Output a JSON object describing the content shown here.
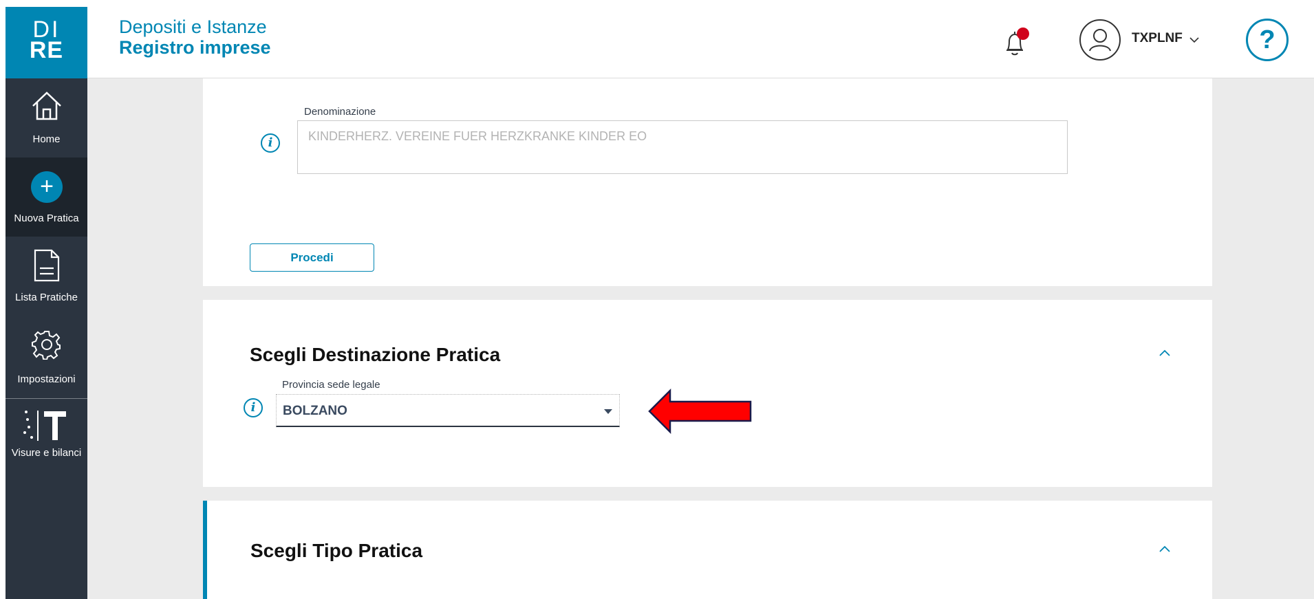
{
  "logo": {
    "line1": "DI",
    "line2": "RE"
  },
  "header": {
    "title": "Depositi e Istanze",
    "subtitle": "Registro imprese",
    "user": "TXPLNF",
    "help_label": "?"
  },
  "sidebar": {
    "items": [
      {
        "label": "Home",
        "icon": "home-icon"
      },
      {
        "label": "Nuova Pratica",
        "icon": "plus-icon"
      },
      {
        "label": "Lista Pratiche",
        "icon": "document-icon"
      },
      {
        "label": "Impostazioni",
        "icon": "gear-icon"
      },
      {
        "label": "Visure e bilanci",
        "icon": "visure-icon"
      }
    ]
  },
  "card1": {
    "field_label": "Denominazione",
    "field_value": "KINDERHERZ. VEREINE FUER HERZKRANKE KINDER EO",
    "button": "Procedi"
  },
  "card2": {
    "title": "Scegli Destinazione Pratica",
    "field_label": "Provincia sede legale",
    "field_value": "BOLZANO"
  },
  "card3": {
    "title": "Scegli Tipo Pratica"
  },
  "colors": {
    "accent": "#0086b3",
    "sidebar": "#2b3440",
    "notification": "#d0021b",
    "arrow": "#ff0000"
  }
}
